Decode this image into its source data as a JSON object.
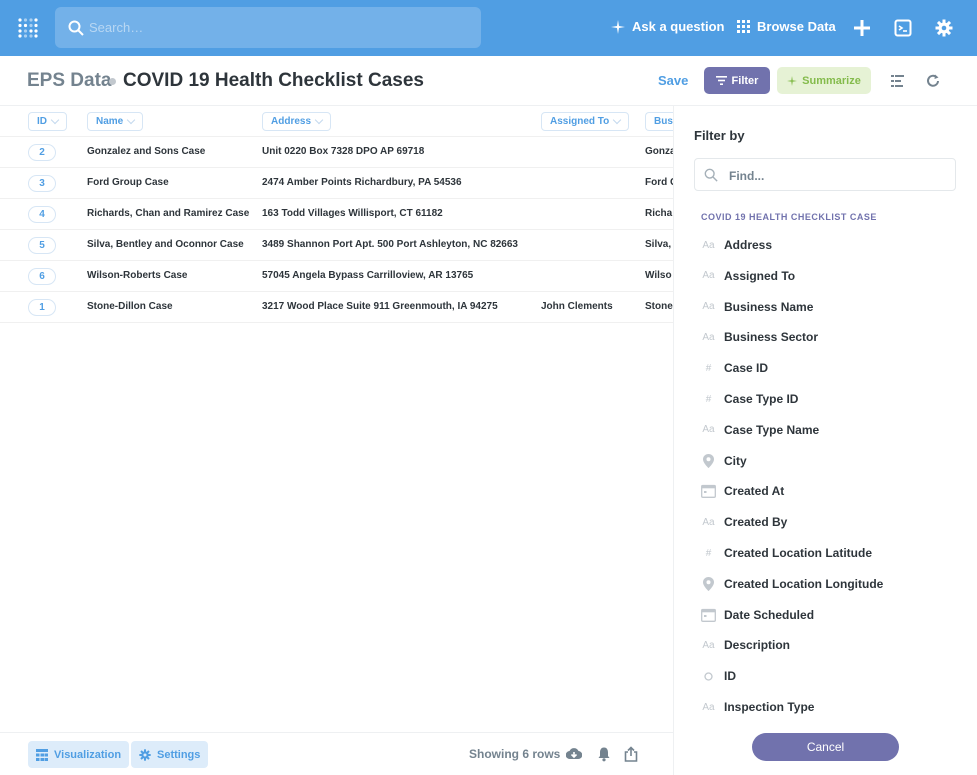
{
  "topbar": {
    "search_placeholder": "Search…",
    "ask_question": "Ask a question",
    "browse_data": "Browse Data"
  },
  "header": {
    "database": "EPS Data",
    "title": "COVID 19 Health Checklist Cases",
    "save": "Save",
    "filter": "Filter",
    "summarize": "Summarize"
  },
  "table": {
    "columns": [
      "ID",
      "Name",
      "Address",
      "Assigned To",
      "Busi"
    ],
    "rows": [
      {
        "id": "2",
        "name": "Gonzalez and Sons Case",
        "address": "Unit 0220 Box 7328 DPO AP 69718",
        "assigned": "",
        "business": "Gonza"
      },
      {
        "id": "3",
        "name": "Ford Group Case",
        "address": "2474 Amber Points Richardbury, PA 54536",
        "assigned": "",
        "business": "Ford G"
      },
      {
        "id": "4",
        "name": "Richards, Chan and Ramirez Case",
        "address": "163 Todd Villages Willisport, CT 61182",
        "assigned": "",
        "business": "Richa"
      },
      {
        "id": "5",
        "name": "Silva, Bentley and Oconnor Case",
        "address": "3489 Shannon Port Apt. 500 Port Ashleyton, NC 82663",
        "assigned": "",
        "business": "Silva,"
      },
      {
        "id": "6",
        "name": "Wilson-Roberts Case",
        "address": "57045 Angela Bypass Carrilloview, AR 13765",
        "assigned": "",
        "business": "Wilso"
      },
      {
        "id": "1",
        "name": "Stone-Dillon Case",
        "address": "3217 Wood Place Suite 911 Greenmouth, IA 94275",
        "assigned": "John Clements",
        "business": "Stone"
      }
    ]
  },
  "footer": {
    "visualization": "Visualization",
    "settings": "Settings",
    "rows_text": "Showing 6 rows"
  },
  "sidebar": {
    "title": "Filter by",
    "find_placeholder": "Find...",
    "section": "COVID 19 HEALTH CHECKLIST CASE",
    "fields": [
      {
        "label": "Address",
        "type": "text"
      },
      {
        "label": "Assigned To",
        "type": "text"
      },
      {
        "label": "Business Name",
        "type": "text"
      },
      {
        "label": "Business Sector",
        "type": "text"
      },
      {
        "label": "Case ID",
        "type": "number"
      },
      {
        "label": "Case Type ID",
        "type": "number"
      },
      {
        "label": "Case Type Name",
        "type": "text"
      },
      {
        "label": "City",
        "type": "location"
      },
      {
        "label": "Created At",
        "type": "date"
      },
      {
        "label": "Created By",
        "type": "text"
      },
      {
        "label": "Created Location Latitude",
        "type": "number"
      },
      {
        "label": "Created Location Longitude",
        "type": "location"
      },
      {
        "label": "Date Scheduled",
        "type": "date"
      },
      {
        "label": "Description",
        "type": "text"
      },
      {
        "label": "ID",
        "type": "id"
      },
      {
        "label": "Inspection Type",
        "type": "text"
      }
    ],
    "cancel": "Cancel"
  },
  "colors": {
    "brand": "#509ee3",
    "filter": "#7172ad",
    "summarize": "#84bb4c"
  }
}
